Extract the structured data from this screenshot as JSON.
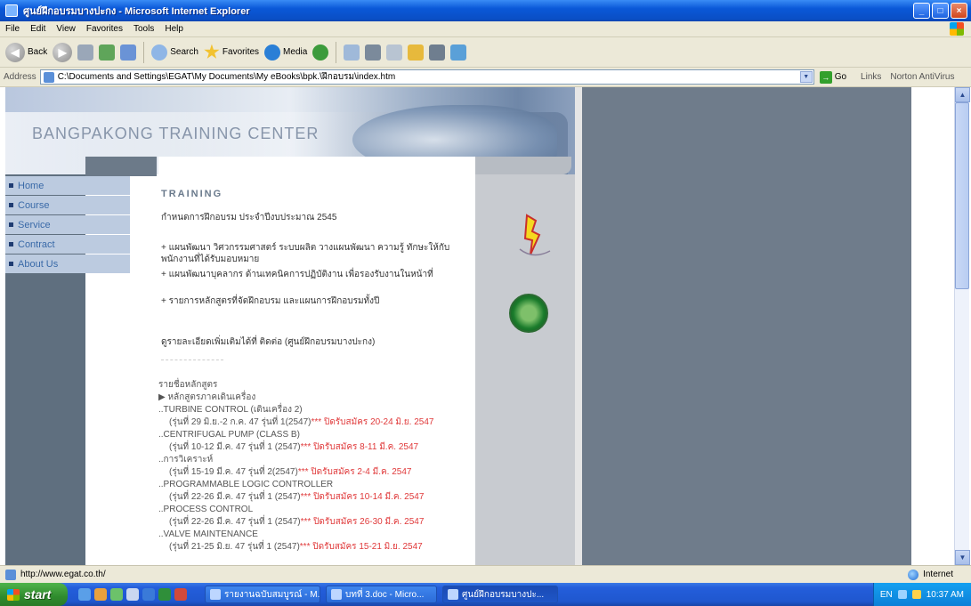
{
  "window": {
    "title": "ศูนย์ฝึกอบรมบางปะกง - Microsoft Internet Explorer",
    "buttons": {
      "minimize": "_",
      "maximize": "□",
      "close": "×"
    }
  },
  "menubar": {
    "items": [
      "File",
      "Edit",
      "View",
      "Favorites",
      "Tools",
      "Help"
    ]
  },
  "toolbar": {
    "back": "Back",
    "search": "Search",
    "favorites": "Favorites",
    "media": "Media"
  },
  "addressbar": {
    "label": "Address",
    "url": "C:\\Documents and Settings\\EGAT\\My Documents\\My eBooks\\bpk.\\ฝึกอบรม\\index.htm",
    "go": "Go",
    "links": "Links",
    "norton": "Norton AntiVirus"
  },
  "site": {
    "title": "BANGPAKONG TRAINING CENTER",
    "nav": [
      "Home",
      "Course",
      "Service",
      "Contract",
      "About Us"
    ],
    "section_heading": "TRAINING",
    "announcement": "กำหนดการฝึกอบรม ประจำปีงบประมาณ 2545",
    "bullets": [
      "+ แผนพัฒนา วิศวกรรมศาสตร์ ระบบผลิต วางแผนพัฒนา ความรู้ ทักษะให้กับพนักงานที่ได้รับมอบหมาย",
      "+ แผนพัฒนาบุคลากร ด้านเทคนิคการปฏิบัติงาน เพื่อรองรับงานในหน้าที่",
      "+ รายการหลักสูตรที่จัดฝึกอบรม และแผนการฝึกอบรมทั้งปี"
    ],
    "note": "ดูรายละเอียดเพิ่มเติมได้ที่ ติดต่อ (ศูนย์ฝึกอบรมบางปะกง)",
    "course_heading": "รายชื่อหลักสูตร",
    "course_subheading": "หลักสูตรภาคเดินเครื่อง",
    "courses": [
      {
        "name": "..TURBINE CONTROL (เดินเครื่อง 2)",
        "date": "(รุ่นที่ 29 มิ.ย.-2 ก.ค. 47 รุ่นที่ 1(2547)",
        "deadline": "*** ปิดรับสมัคร 20-24 มิ.ย. 2547"
      },
      {
        "name": "..CENTRIFUGAL PUMP (CLASS B)",
        "date": "(รุ่นที่ 10-12 มี.ค. 47 รุ่นที่ 1 (2547)",
        "deadline": "*** ปิดรับสมัคร 8-11 มี.ค. 2547"
      },
      {
        "name": "..การวิเคราะห์",
        "date": "(รุ่นที่ 15-19 มี.ค. 47 รุ่นที่ 2(2547)",
        "deadline": "*** ปิดรับสมัคร 2-4 มี.ค. 2547"
      },
      {
        "name": "..PROGRAMMABLE LOGIC CONTROLLER",
        "date": "(รุ่นที่ 22-26 มี.ค. 47 รุ่นที่ 1 (2547)",
        "deadline": "*** ปิดรับสมัคร 10-14 มี.ค. 2547"
      },
      {
        "name": "..PROCESS CONTROL",
        "date": "(รุ่นที่ 22-26 มี.ค. 47 รุ่นที่ 1 (2547)",
        "deadline": "*** ปิดรับสมัคร 26-30 มี.ค. 2547"
      },
      {
        "name": "..VALVE MAINTENANCE",
        "date": "(รุ่นที่ 21-25 มิ.ย. 47 รุ่นที่ 1 (2547)",
        "deadline": "*** ปิดรับสมัคร 15-21 มิ.ย. 2547"
      }
    ]
  },
  "statusbar": {
    "text": "http://www.egat.co.th/",
    "zone": "Internet"
  },
  "taskbar": {
    "start": "start",
    "tasks": [
      "รายงานฉบับสมบูรณ์ - M...",
      "บทที่ 3.doc - Micro...",
      "ศูนย์ฝึกอบรมบางปะ..."
    ],
    "clock": "10:37 AM",
    "lang": "EN"
  }
}
